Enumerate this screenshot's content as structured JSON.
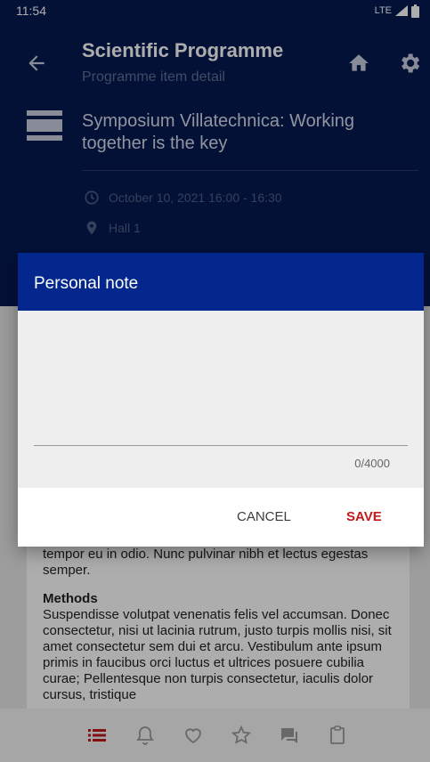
{
  "status_bar": {
    "time": "11:54",
    "network": "LTE"
  },
  "app_bar": {
    "title": "Scientific Programme",
    "subtitle": "Programme item detail"
  },
  "session": {
    "title": "Symposium Villatechnica: Working together is the key",
    "datetime": "October 10, 2021 16:00 - 16:30",
    "location": "Hall 1"
  },
  "content": {
    "paragraph_end": "tempor eu in odio. Nunc pulvinar nibh et lectus egestas semper.",
    "methods_heading": "Methods",
    "methods_text": "Suspendisse volutpat venenatis felis vel accumsan. Donec consectetur, nisi ut lacinia rutrum, justo turpis mollis nisi, sit amet consectetur sem dui et arcu. Vestibulum ante ipsum primis in faucibus orci luctus et ultrices posuere cubilia curae; Pellentesque non turpis consectetur, iaculis dolor cursus, tristique"
  },
  "bottom_nav": {
    "items": [
      "list-icon",
      "bell-icon",
      "heart-icon",
      "star-icon",
      "chat-icon",
      "clipboard-icon"
    ],
    "active_color": "#c21a1a",
    "inactive_color": "#9a9a9a"
  },
  "dialog": {
    "title": "Personal note",
    "note_value": "",
    "counter": "0/4000",
    "cancel_label": "CANCEL",
    "save_label": "SAVE"
  },
  "colors": {
    "header_bg": "#051a52",
    "dialog_header_bg": "#03278c",
    "accent": "#c21a1a"
  }
}
